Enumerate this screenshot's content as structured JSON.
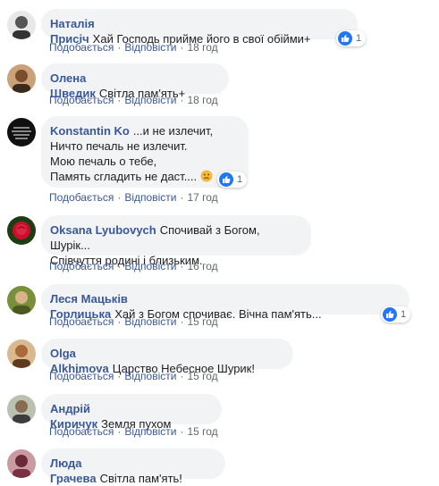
{
  "actions": {
    "like": "Подобається",
    "reply": "Відповісти",
    "separator": "·"
  },
  "comments": [
    {
      "author": "Наталія Присіч",
      "text": "Хай Господь прийме його в свої обійми+",
      "time": "18 год",
      "reactions": "1"
    },
    {
      "author": "Олена Шведик",
      "text": "Світла пам'ять+",
      "time": "18 год"
    },
    {
      "author": "Konstantin Ko",
      "text": "...и не излечит,\nНичто печаль не излечит.\nМою печаль о тебе,\nПамять сгладить не даст....",
      "emoji": "frowning-face",
      "time": "17 год",
      "reactions": "1"
    },
    {
      "author": "Oksana Lyubovych",
      "text": "Спочивай з Богом, Шурік...\nСпівчуття родині і близьким.",
      "time": "16 год"
    },
    {
      "author": "Леся Мацьків Горлицька",
      "text": "Хай з Богом спочиває. Вічна пам'ять...",
      "time": "15 год",
      "reactions": "1"
    },
    {
      "author": "Olga Alkhimova",
      "text": "Царство Небесное Шурик!",
      "time": "15 год"
    },
    {
      "author": "Андрій Киричук",
      "text": "Земля пухом",
      "time": "15 год"
    },
    {
      "author": "Люда Грачева",
      "text": "Світла пам'ять!",
      "time": ""
    }
  ],
  "colors": {
    "author": "#385898",
    "bubble": "#f2f3f5",
    "like": "#2078f4",
    "meta": "#606770"
  }
}
